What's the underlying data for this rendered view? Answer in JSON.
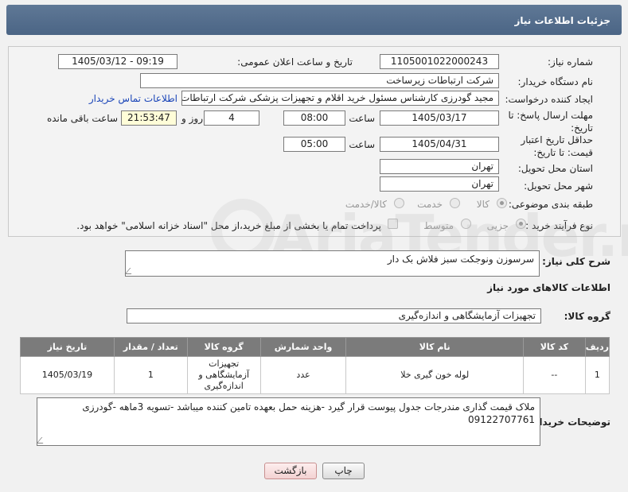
{
  "header": {
    "title": "جزئیات اطلاعات نیاز"
  },
  "form": {
    "need_number_label": "شماره نیاز:",
    "need_number": "1105001022000243",
    "announce_label": "تاریخ و ساعت اعلان عمومی:",
    "announce_value": "1405/03/12 - 09:19",
    "buyer_org_label": "نام دستگاه خریدار:",
    "buyer_org": "شرکت ارتباطات زیرساخت",
    "creator_label": "ایجاد کننده درخواست:",
    "creator": "مجید گودرزی کارشناس مسئول خرید اقلام و تجهیزات پزشکی شرکت ارتباطات ز",
    "contact_link": "اطلاعات تماس خریدار",
    "reply_deadline_label": "مهلت ارسال پاسخ: تا تاریخ:",
    "reply_date": "1405/03/17",
    "time_label": "ساعت",
    "reply_time": "08:00",
    "days_value": "4",
    "days_label": "روز و",
    "remaining_time": "21:53:47",
    "remaining_label": "ساعت باقی مانده",
    "price_validity_label": "حداقل تاریخ اعتبار قیمت: تا تاریخ:",
    "validity_date": "1405/04/31",
    "validity_time": "05:00",
    "province_label": "استان محل تحویل:",
    "province": "تهران",
    "city_label": "شهر محل تحویل:",
    "city": "تهران",
    "category_label": "طبقه بندی موضوعی:",
    "category_options": [
      "کالا",
      "خدمت",
      "کالا/خدمت"
    ],
    "process_label": "نوع فرآیند خرید :",
    "process_options": [
      "جزیی",
      "متوسط"
    ],
    "payment_note": "پرداخت تمام یا بخشی از مبلغ خرید،از محل \"اسناد خزانه اسلامی\" خواهد بود."
  },
  "summary": {
    "label": "شرح کلی نیاز:",
    "text": "سرسوزن ونوجکت سبز فلاش بک دار"
  },
  "goods_section_title": "اطلاعات کالاهای مورد نیاز",
  "goods_group": {
    "label": "گروه کالا:",
    "value": "تجهیزات آزمایشگاهی و اندازه‌گیری"
  },
  "table": {
    "headers": [
      "ردیف",
      "کد کالا",
      "نام کالا",
      "واحد شمارش",
      "گروه کالا",
      "تعداد / مقدار",
      "تاریخ نیاز"
    ],
    "rows": [
      [
        "1",
        "--",
        "لوله خون گیری خلا",
        "عدد",
        "تجهیزات آزمایشگاهی و اندازه‌گیری",
        "1",
        "1405/03/19"
      ]
    ]
  },
  "buyer_notes": {
    "label": "توضیحات خریدار:",
    "text": "ملاک قیمت گذاری مندرجات جدول پیوست قرار گیرد -هزینه حمل بعهده تامین کننده میباشد -تسویه 3ماهه -گودرزی 09122707761"
  },
  "buttons": {
    "print": "چاپ",
    "back": "بازگشت"
  },
  "watermark": "AriaTender.net"
}
